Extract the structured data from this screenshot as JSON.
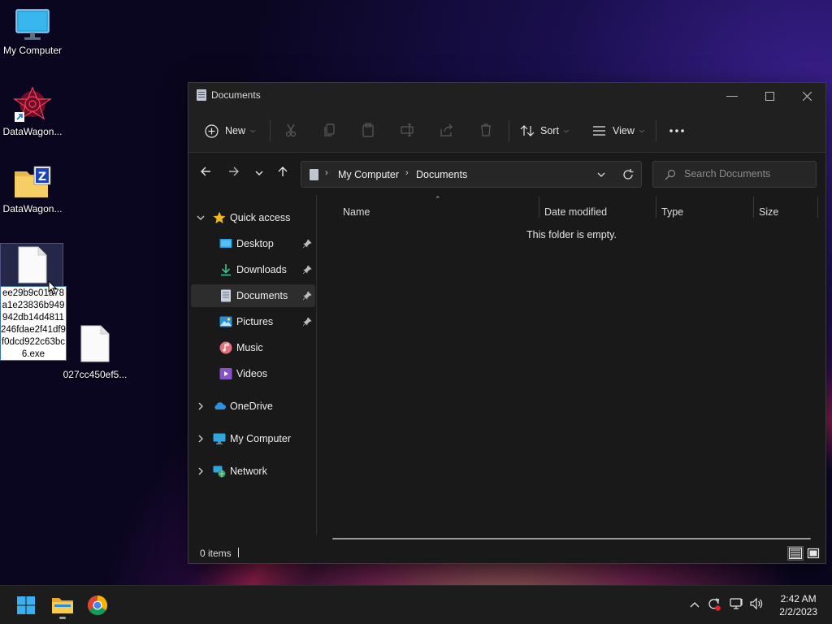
{
  "desktop": {
    "icons": [
      {
        "label": "My Computer"
      },
      {
        "label": "DataWagon..."
      },
      {
        "label": "DataWagon..."
      },
      {
        "label": "027cc450ef5..."
      }
    ],
    "rename_value": "ee29b9c01a78a1e23836b949942db14d4811246fdae2f41df9f0dcd922c63bc6.exe"
  },
  "window": {
    "title": "Documents",
    "toolbar": {
      "new_label": "New",
      "sort_label": "Sort",
      "view_label": "View",
      "more_label": "…"
    },
    "address": {
      "crumbs": [
        "My Computer",
        "Documents"
      ]
    },
    "search": {
      "placeholder": "Search Documents"
    },
    "navpane": {
      "quick_access": "Quick access",
      "items": [
        {
          "label": "Desktop",
          "pinned": true
        },
        {
          "label": "Downloads",
          "pinned": true
        },
        {
          "label": "Documents",
          "pinned": true
        },
        {
          "label": "Pictures",
          "pinned": true
        },
        {
          "label": "Music",
          "pinned": false
        },
        {
          "label": "Videos",
          "pinned": false
        }
      ],
      "roots": [
        "OneDrive",
        "My Computer",
        "Network"
      ]
    },
    "columns": [
      "Name",
      "Date modified",
      "Type",
      "Size"
    ],
    "empty_message": "This folder is empty.",
    "status": {
      "items_count": "0 items"
    }
  },
  "taskbar": {
    "clock": {
      "time": "2:42 AM",
      "date": "2/2/2023"
    }
  },
  "colors": {
    "window_bg": "#191919",
    "toolbar_bg": "#202020",
    "accent_blue": "#2b88d8",
    "star_yellow": "#f3b61f"
  }
}
